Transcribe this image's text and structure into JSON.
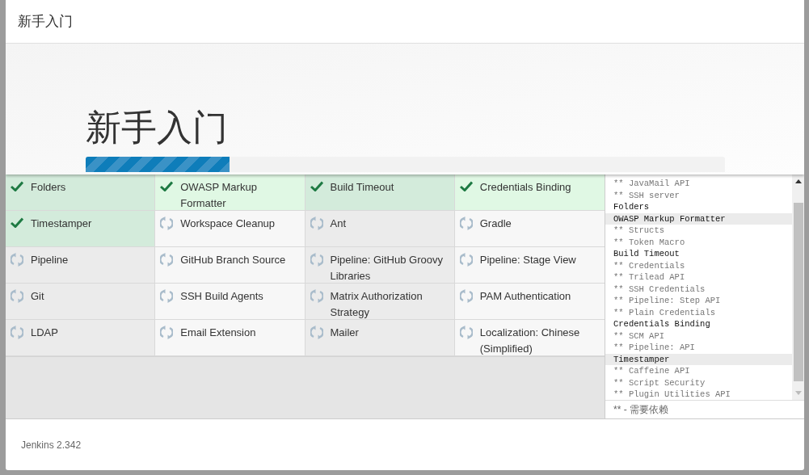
{
  "window": {
    "title": "新手入门"
  },
  "hero": {
    "heading": "新手入门",
    "progress": {
      "level": 0.225
    }
  },
  "plugins": [
    {
      "name": "Folders",
      "installed": true
    },
    {
      "name": "OWASP Markup Formatter",
      "installed": true
    },
    {
      "name": "Build Timeout",
      "installed": true
    },
    {
      "name": "Credentials Binding",
      "installed": true
    },
    {
      "name": "Timestamper",
      "installed": true
    },
    {
      "name": "Workspace Cleanup",
      "installed": false
    },
    {
      "name": "Ant",
      "installed": false
    },
    {
      "name": "Gradle",
      "installed": false
    },
    {
      "name": "Pipeline",
      "installed": false
    },
    {
      "name": "GitHub Branch Source",
      "installed": false
    },
    {
      "name": "Pipeline: GitHub Groovy Libraries",
      "installed": false
    },
    {
      "name": "Pipeline: Stage View",
      "installed": false
    },
    {
      "name": "Git",
      "installed": false
    },
    {
      "name": "SSH Build Agents",
      "installed": false
    },
    {
      "name": "Matrix Authorization Strategy",
      "installed": false
    },
    {
      "name": "PAM Authentication",
      "installed": false
    },
    {
      "name": "LDAP",
      "installed": false
    },
    {
      "name": "Email Extension",
      "installed": false
    },
    {
      "name": "Mailer",
      "installed": false
    },
    {
      "name": "Localization: Chinese (Simplified)",
      "installed": false
    }
  ],
  "log": {
    "lines": [
      {
        "text": "** JavaMail API",
        "kind": "dependency",
        "highlighted": false
      },
      {
        "text": "** SSH server",
        "kind": "dependency",
        "highlighted": false
      },
      {
        "text": "Folders",
        "kind": "plugin",
        "highlighted": false
      },
      {
        "text": "OWASP Markup Formatter",
        "kind": "plugin",
        "highlighted": true
      },
      {
        "text": "** Structs",
        "kind": "dependency",
        "highlighted": false
      },
      {
        "text": "** Token Macro",
        "kind": "dependency",
        "highlighted": false
      },
      {
        "text": "Build Timeout",
        "kind": "plugin",
        "highlighted": false
      },
      {
        "text": "** Credentials",
        "kind": "dependency",
        "highlighted": false
      },
      {
        "text": "** Trilead API",
        "kind": "dependency",
        "highlighted": false
      },
      {
        "text": "** SSH Credentials",
        "kind": "dependency",
        "highlighted": false
      },
      {
        "text": "** Pipeline: Step API",
        "kind": "dependency",
        "highlighted": false
      },
      {
        "text": "** Plain Credentials",
        "kind": "dependency",
        "highlighted": false
      },
      {
        "text": "Credentials Binding",
        "kind": "plugin",
        "highlighted": false
      },
      {
        "text": "** SCM API",
        "kind": "dependency",
        "highlighted": false
      },
      {
        "text": "** Pipeline: API",
        "kind": "dependency",
        "highlighted": false
      },
      {
        "text": "Timestamper",
        "kind": "plugin",
        "highlighted": true
      },
      {
        "text": "** Caffeine API",
        "kind": "dependency",
        "highlighted": false
      },
      {
        "text": "** Script Security",
        "kind": "dependency",
        "highlighted": false
      },
      {
        "text": "** Plugin Utilities API",
        "kind": "dependency",
        "highlighted": false
      }
    ],
    "legend": "** - 需要依赖"
  },
  "footer": {
    "version": "Jenkins 2.342"
  }
}
